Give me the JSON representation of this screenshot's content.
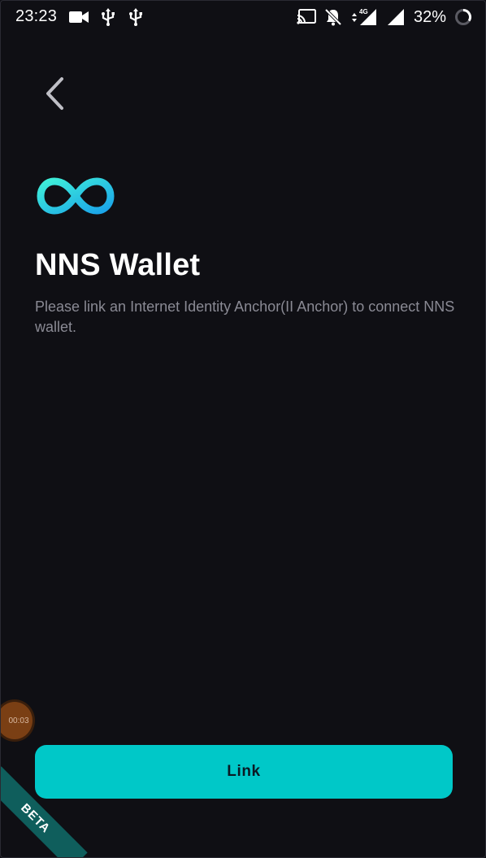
{
  "status_bar": {
    "time": "23:23",
    "battery_percent": "32%",
    "network": "4G"
  },
  "header": {
    "back_icon": "chevron-left-icon"
  },
  "logo": {
    "icon": "infinity-logo-icon",
    "colors": [
      "#2ee6d6",
      "#1aa7e8"
    ]
  },
  "main": {
    "title": "NNS Wallet",
    "description": "Please link an Internet Identity Anchor(II Anchor) to connect NNS wallet."
  },
  "actions": {
    "link_label": "Link",
    "accent_color": "#00c8c8"
  },
  "overlay": {
    "recording_time": "00:03",
    "beta_label": "BETA"
  }
}
